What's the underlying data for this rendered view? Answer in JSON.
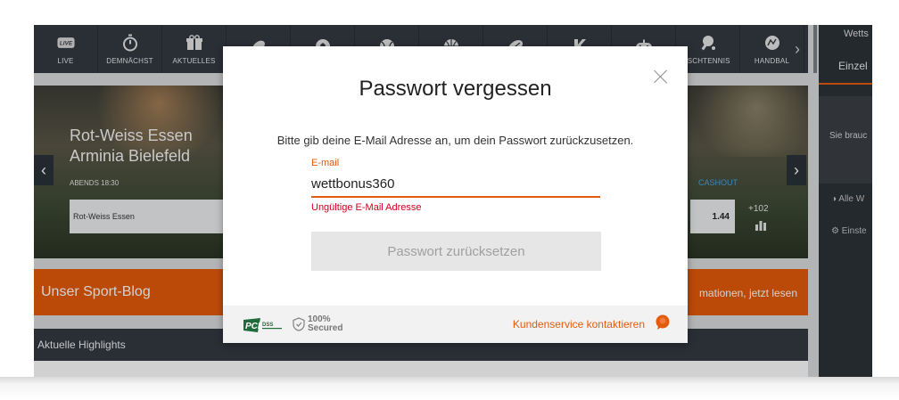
{
  "nav": {
    "items": [
      {
        "label": "LIVE",
        "icon": "live-icon"
      },
      {
        "label": "DEMNÄCHST",
        "icon": "stopwatch-icon"
      },
      {
        "label": "AKTUELLES",
        "icon": "gift-icon"
      },
      {
        "label": "",
        "icon": "american-football-icon"
      },
      {
        "label": "",
        "icon": "soccer-ball-icon"
      },
      {
        "label": "",
        "icon": "tennis-ball-icon"
      },
      {
        "label": "",
        "icon": "basketball-icon"
      },
      {
        "label": "",
        "icon": "rugby-ball-icon"
      },
      {
        "label": "",
        "icon": "k-icon"
      },
      {
        "label": "",
        "icon": "gamepad-icon"
      },
      {
        "label": "ISCHTENNIS",
        "icon": "table-tennis-icon"
      },
      {
        "label": "HANDBAL",
        "icon": "handball-icon"
      }
    ],
    "live_badge": "LIVE",
    "next_glyph": "›"
  },
  "banner": {
    "team1": "Rot-Weiss Essen",
    "team2": "Arminia Bielefeld",
    "kickoff": "ABENDS 18:30",
    "odd_team": "Rot-Weiss Essen",
    "cashout": "CASHOUT",
    "odd_value": "1.44",
    "more_markets": "+102",
    "prev_glyph": "‹",
    "next_glyph": "›"
  },
  "blog": {
    "title": "Unser Sport-Blog",
    "link_text": "mationen, jetzt lesen"
  },
  "highlights": {
    "title": "Aktuelle Highlights"
  },
  "sidebar": {
    "title": "Wetts",
    "tab": "Einzel",
    "text": "Sie brauc",
    "item1": "Alle W",
    "item2": "Einste"
  },
  "modal": {
    "title": "Passwort vergessen",
    "instruction": "Bitte gib deine E-Mail Adresse an, um dein Passwort zurückzusetzen.",
    "email_label": "E-mail",
    "email_value": "wettbonus360",
    "error": "Ungültige E-Mail Adresse",
    "reset_button": "Passwort zurücksetzen",
    "pci_text": "PCI DSS",
    "secured_pct": "100%",
    "secured_text": "Secured",
    "support_link": "Kundenservice kontaktieren"
  },
  "colors": {
    "accent": "#e35b0d",
    "error": "#d0021b",
    "nav_bg": "#343a41",
    "blog_bg": "#e55b0b",
    "cashout": "#4aa3df"
  }
}
